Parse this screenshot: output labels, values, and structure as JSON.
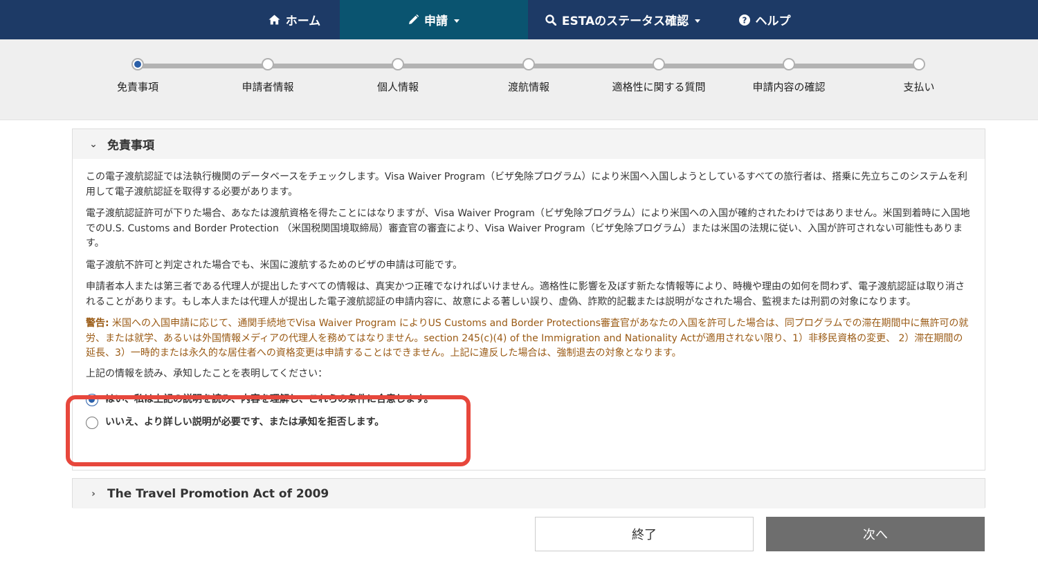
{
  "nav": {
    "home": "ホーム",
    "apply": "申請",
    "status": "ESTAのステータス確認",
    "help": "ヘルプ"
  },
  "steps": [
    {
      "label": "免責事項",
      "current": true
    },
    {
      "label": "申請者情報",
      "current": false
    },
    {
      "label": "個人情報",
      "current": false
    },
    {
      "label": "渡航情報",
      "current": false
    },
    {
      "label": "適格性に関する質問",
      "current": false
    },
    {
      "label": "申請内容の確認",
      "current": false
    },
    {
      "label": "支払い",
      "current": false
    }
  ],
  "disclaimer": {
    "title": "免責事項",
    "paragraphs": [
      "この電子渡航認証では法執行機関のデータベースをチェックします。Visa Waiver Program（ビザ免除プログラム）により米国へ入国しようとしているすべての旅行者は、搭乗に先立ちこのシステムを利用して電子渡航認証を取得する必要があります。",
      "電子渡航認証許可が下りた場合、あなたは渡航資格を得たことにはなりますが、Visa Waiver Program（ビザ免除プログラム）により米国への入国が確約されたわけではありません。米国到着時に入国地でのU.S. Customs and Border Protection （米国税関国境取締局）審査官の審査により、Visa Waiver Program（ビザ免除プログラム）または米国の法規に従い、入国が許可されない可能性もあります。",
      "電子渡航不許可と判定された場合でも、米国に渡航するためのビザの申請は可能です。",
      "申請者本人または第三者である代理人が提出したすべての情報は、真実かつ正確でなければいけません。適格性に影響を及ぼす新たな情報等により、時機や理由の如何を問わず、電子渡航認証は取り消されることがあります。もし本人または代理人が提出した電子渡航認証の申請内容に、故意による著しい誤り、虚偽、詐欺的記載または説明がなされた場合、監視または刑罰の対象になります。"
    ],
    "warning_label": "警告:",
    "warning_text": " 米国への入国申請に応じて、通関手続地でVisa Waiver Program によりUS Customs and Border Protections審査官があなたの入国を許可した場合は、同プログラムでの滞在期間中に無許可の就労、または就学、あるいは外国情報メディアの代理人を務めてはなりません。section 245(c)(4) of the Immigration and Nationality Actが適用されない限り、1）非移民資格の変更、 2）滞在期間の延長、3）一時的または永久的な居住者への資格変更は申請することはできません。上記に違反した場合は、強制退去の対象となります。",
    "ack_prompt": "上記の情報を読み、承知したことを表明してください：",
    "option_yes": "はい、私は上記の説明を読み、内容を理解し、これらの条件に合意します。",
    "option_no": "いいえ、より詳しい説明が必要です、または承知を拒否します。",
    "selected": "yes"
  },
  "travel_act": {
    "title": "The Travel Promotion Act of 2009"
  },
  "buttons": {
    "end": "終了",
    "next": "次へ"
  },
  "colors": {
    "nav_bg": "#1d3a66",
    "nav_active": "#0a5470",
    "accent": "#2b5fa8",
    "warning": "#9a5a14",
    "highlight": "#e7473c",
    "next_button": "#6e6e6e"
  }
}
